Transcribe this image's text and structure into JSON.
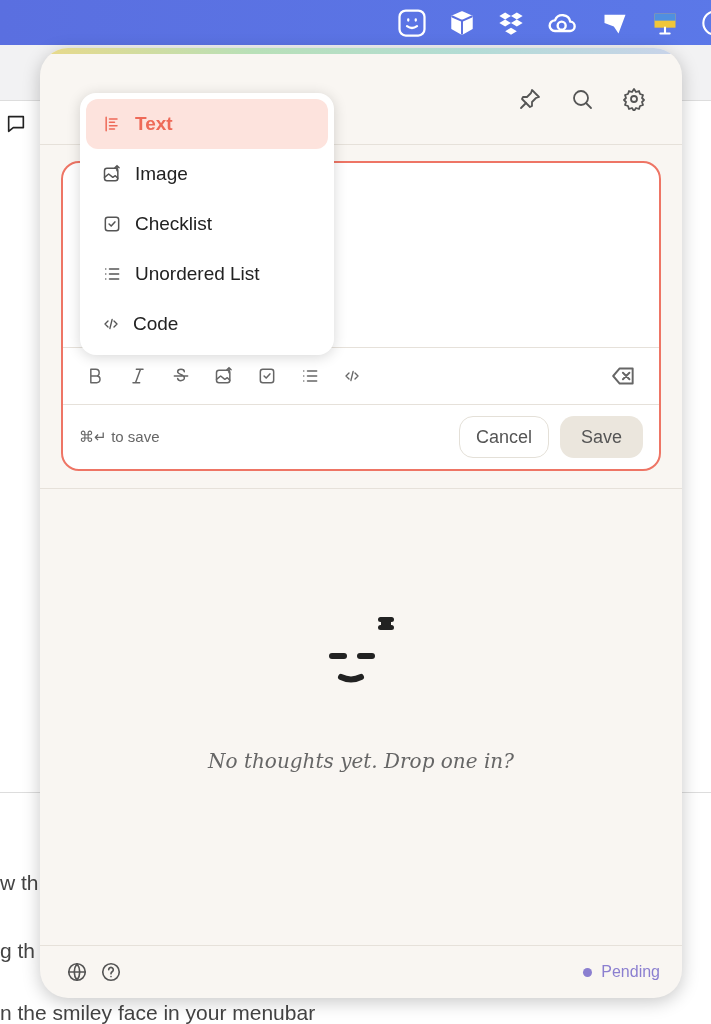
{
  "background_page": {
    "lines": [
      "w th",
      "g th",
      "n the smiley face in your menubar"
    ]
  },
  "panel": {
    "insert_menu": {
      "items": [
        {
          "kind": "text",
          "label": "Text",
          "selected": true
        },
        {
          "kind": "image",
          "label": "Image",
          "selected": false
        },
        {
          "kind": "checklist",
          "label": "Checklist",
          "selected": false
        },
        {
          "kind": "list",
          "label": "Unordered List",
          "selected": false
        },
        {
          "kind": "code",
          "label": "Code",
          "selected": false
        }
      ]
    },
    "editor": {
      "shortcut_hint": "⌘↵ to save",
      "cancel_button": "Cancel",
      "save_button": "Save"
    },
    "empty_state": {
      "message": "No thoughts yet. Drop one in?"
    },
    "footer": {
      "status": {
        "label": "Pending",
        "color": "#8b7fd0"
      }
    }
  }
}
